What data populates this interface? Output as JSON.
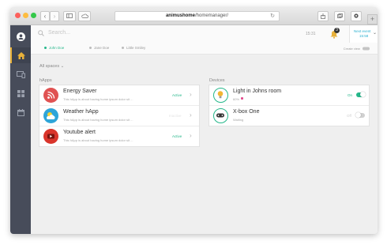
{
  "browser": {
    "url_bold": "animushome",
    "url_rest": "/homemanager/",
    "back_glyph": "‹",
    "forward_glyph": "›",
    "plus_glyph": "+"
  },
  "topbar": {
    "search_placeholder": "Search...",
    "time": "15:31",
    "notification_count": "3",
    "next_event_label": "Next event",
    "next_event_time": "15:58"
  },
  "users": [
    {
      "name": "John Doe",
      "active": true
    },
    {
      "name": "Jane Doe",
      "active": false
    },
    {
      "name": "Little Smiley",
      "active": false
    }
  ],
  "create_view_label": "Create view",
  "spaces_label": "All spaces",
  "happs": {
    "section_label": "hApps",
    "items": [
      {
        "title": "Energy Saver",
        "desc": "This hApp is about having home ipsum dolor sit ...",
        "status": "Active",
        "status_color": "#25b78a",
        "icon": "rss-icon",
        "icon_color": "#e05252"
      },
      {
        "title": "Weather hApp",
        "desc": "This hApp is about having home ipsum dolor sit ...",
        "status": "Inactive",
        "status_color": "#e4e4e4",
        "icon": "weather-icon",
        "icon_color": "#2ea5d8"
      },
      {
        "title": "Youtube alert",
        "desc": "This hApp is about having home ipsum dolor sit ...",
        "status": "Active",
        "status_color": "#25b78a",
        "icon": "youtube-icon",
        "icon_color": "#d9342b"
      }
    ]
  },
  "devices": {
    "section_label": "Devices",
    "items": [
      {
        "title": "Light in Johns room",
        "sub": "60%",
        "state_label": "On",
        "on": true,
        "icon": "bulb-icon"
      },
      {
        "title": "X-box One",
        "sub": "Waiting",
        "state_label": "Off",
        "on": false,
        "icon": "gamepad-icon"
      }
    ]
  },
  "colors": {
    "accent": "#25b78a",
    "sidebar": "#474c5a",
    "highlight": "#e8b13a",
    "link": "#2bb0d0"
  }
}
